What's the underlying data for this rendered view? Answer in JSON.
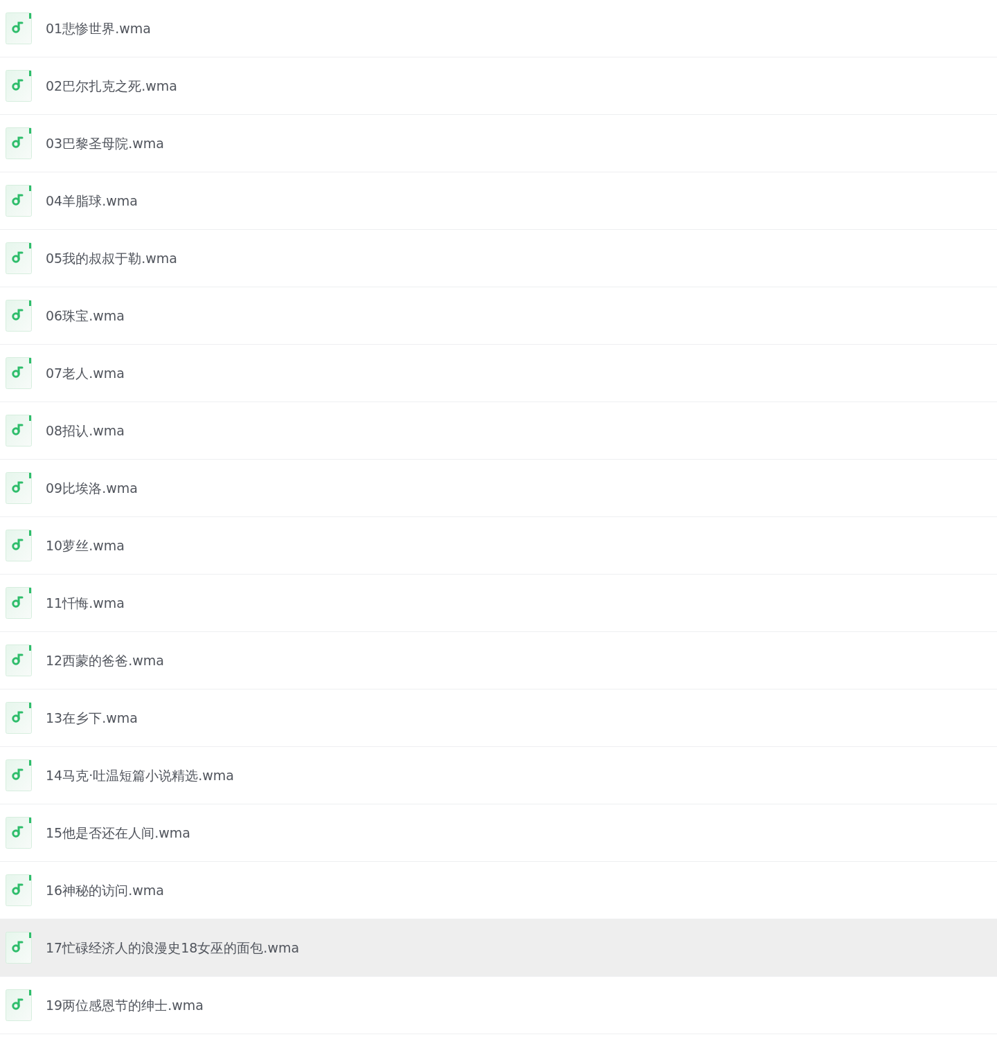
{
  "files": [
    {
      "name": "01悲惨世界.wma",
      "selected": false
    },
    {
      "name": "02巴尔扎克之死.wma",
      "selected": false
    },
    {
      "name": "03巴黎圣母院.wma",
      "selected": false
    },
    {
      "name": "04羊脂球.wma",
      "selected": false
    },
    {
      "name": "05我的叔叔于勒.wma",
      "selected": false
    },
    {
      "name": "06珠宝.wma",
      "selected": false
    },
    {
      "name": "07老人.wma",
      "selected": false
    },
    {
      "name": "08招认.wma",
      "selected": false
    },
    {
      "name": "09比埃洛.wma",
      "selected": false
    },
    {
      "name": "10萝丝.wma",
      "selected": false
    },
    {
      "name": "11忏悔.wma",
      "selected": false
    },
    {
      "name": "12西蒙的爸爸.wma",
      "selected": false
    },
    {
      "name": "13在乡下.wma",
      "selected": false
    },
    {
      "name": "14马克·吐温短篇小说精选.wma",
      "selected": false
    },
    {
      "name": "15他是否还在人间.wma",
      "selected": false
    },
    {
      "name": "16神秘的访问.wma",
      "selected": false
    },
    {
      "name": "17忙碌经济人的浪漫史18女巫的面包.wma",
      "selected": true
    },
    {
      "name": "19两位感恩节的绅士.wma",
      "selected": false
    }
  ]
}
